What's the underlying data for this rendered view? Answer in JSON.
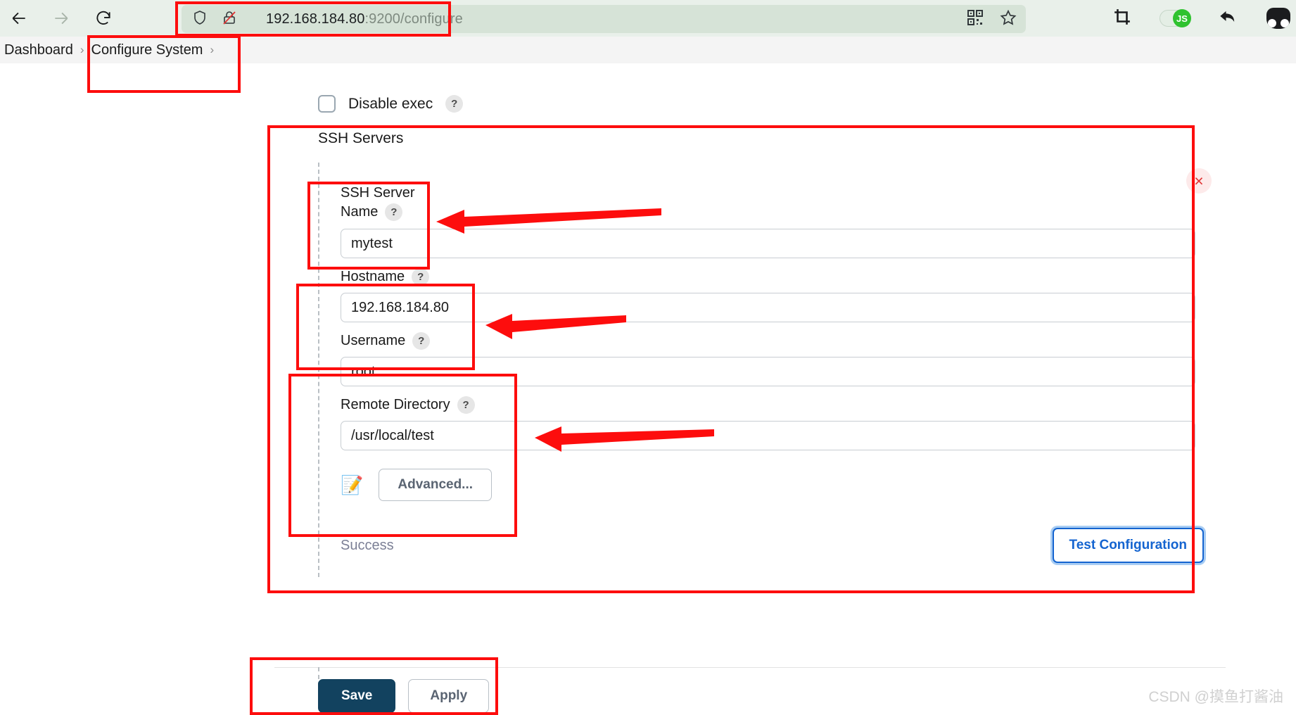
{
  "browser": {
    "back_icon": "back-arrow-icon",
    "forward_icon": "forward-arrow-icon",
    "reload_icon": "reload-icon",
    "shield_icon": "shield-icon",
    "insecure_icon": "insecure-lock-icon",
    "url_host": "192.168.184.80",
    "url_rest": ":9200/configure",
    "qr_icon": "qr-code-icon",
    "bookmark_icon": "star-bookmark-icon",
    "crop_icon": "crop-screenshot-icon",
    "js_toggle_label": "JS",
    "undo_icon": "undo-arrow-icon",
    "profile_icon": "profile-avatar-icon"
  },
  "breadcrumb": {
    "items": [
      "Dashboard",
      "Configure System"
    ],
    "separator": "›"
  },
  "form": {
    "disable_exec_label": "Disable exec",
    "help_glyph": "?",
    "section_title": "SSH Servers",
    "remove_glyph": "×",
    "fields": [
      {
        "label": "SSH Server Name",
        "value": "mytest"
      },
      {
        "label": "Hostname",
        "value": "192.168.184.80"
      },
      {
        "label": "Username",
        "value": "root"
      },
      {
        "label": "Remote Directory",
        "value": "/usr/local/test"
      }
    ],
    "note_icon": "📝",
    "advanced_label": "Advanced...",
    "status_text": "Success",
    "test_label": "Test Configuration",
    "save_label": "Save",
    "apply_label": "Apply"
  },
  "watermark": "CSDN @摸鱼打酱油"
}
